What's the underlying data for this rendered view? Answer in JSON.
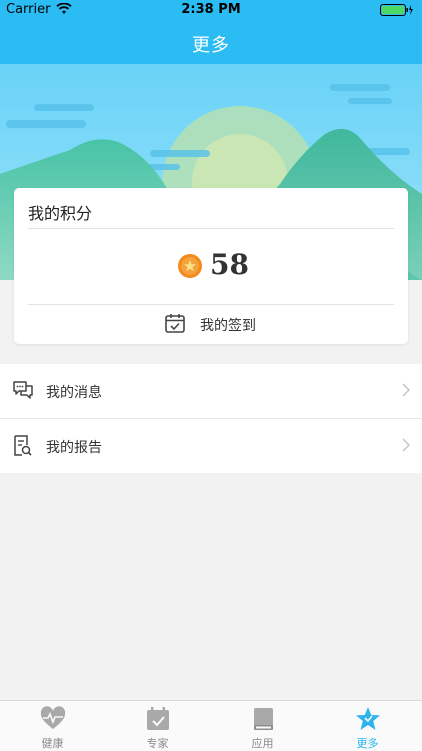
{
  "status_bar": {
    "carrier": "Carrier",
    "time": "2:38 PM"
  },
  "nav": {
    "title": "更多"
  },
  "points_card": {
    "title": "我的积分",
    "points": "58",
    "checkin_label": "我的签到"
  },
  "menu": {
    "items": [
      {
        "label": "我的消息",
        "icon": "chat-bubbles-icon"
      },
      {
        "label": "我的报告",
        "icon": "report-search-icon"
      }
    ]
  },
  "tabs": [
    {
      "label": "健康",
      "icon": "heart-pulse-icon",
      "active": false
    },
    {
      "label": "专家",
      "icon": "calendar-check-icon",
      "active": false
    },
    {
      "label": "应用",
      "icon": "book-icon",
      "active": false
    },
    {
      "label": "更多",
      "icon": "star-icon",
      "active": true
    }
  ],
  "colors": {
    "primary": "#2bbcf3",
    "accent_tab": "#2bb4ef",
    "coin": "#f28a1c"
  }
}
